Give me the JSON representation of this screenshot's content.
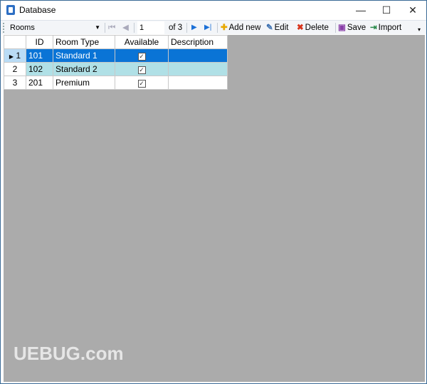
{
  "window": {
    "title": "Database",
    "minimize": "—",
    "maximize": "☐",
    "close": "✕"
  },
  "toolbar": {
    "table_select": "Rooms",
    "position": "1",
    "of_label": "of 3",
    "add_new": "Add new",
    "edit": "Edit",
    "delete": "Delete",
    "save": "Save",
    "import": "Import"
  },
  "grid": {
    "columns": [
      "ID",
      "Room Type",
      "Available",
      "Description"
    ],
    "rows": [
      {
        "num": "1",
        "id": "101",
        "room_type": "Standard 1",
        "available": true,
        "description": "",
        "selected": true
      },
      {
        "num": "2",
        "id": "102",
        "room_type": "Standard 2",
        "available": true,
        "description": ""
      },
      {
        "num": "3",
        "id": "201",
        "room_type": "Premium",
        "available": true,
        "description": ""
      }
    ]
  },
  "colors": {
    "selected_row": "#0a74d6",
    "alt_row": "#b0e0e6",
    "background": "#ababab"
  },
  "watermark": "UEBUG.com"
}
